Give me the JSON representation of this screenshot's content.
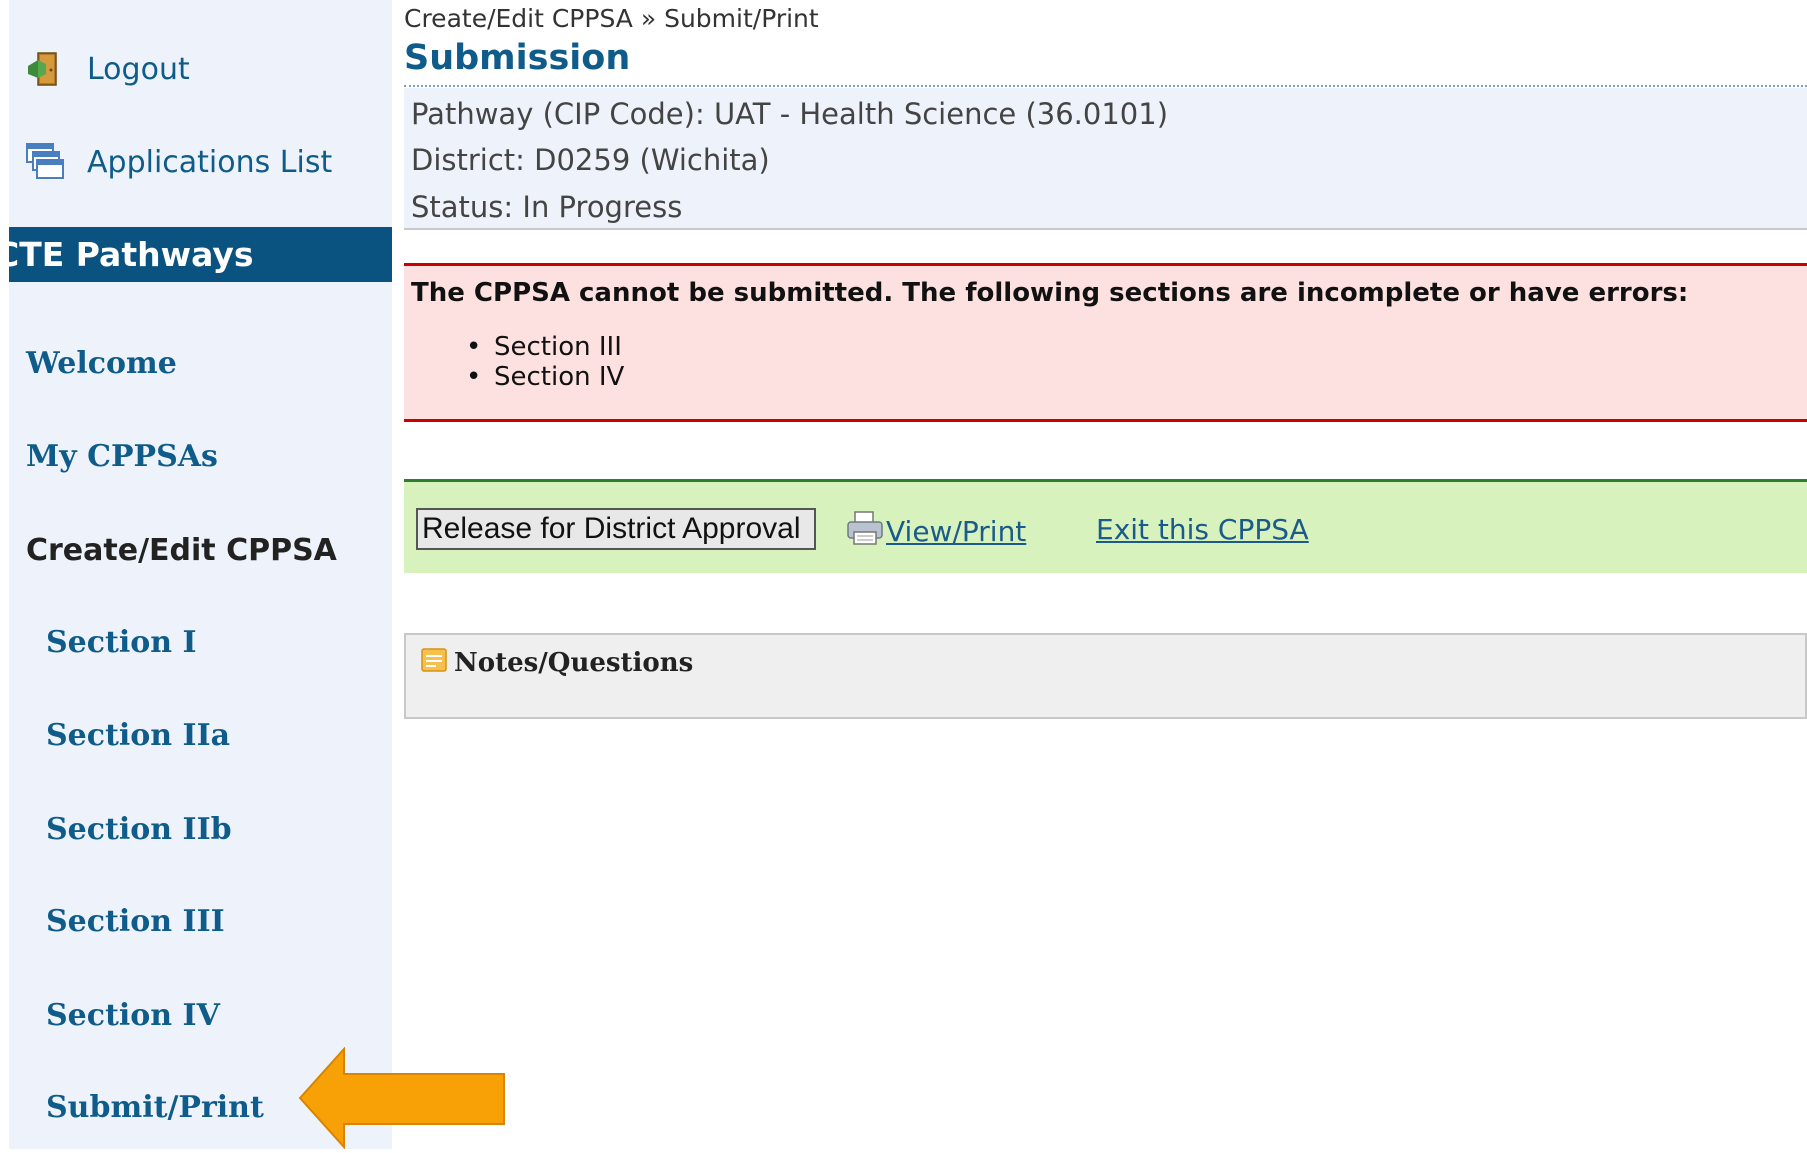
{
  "sidebar": {
    "logout_label": "Logout",
    "applications_label": "Applications List",
    "header": "CTE Pathways",
    "nav": {
      "welcome": "Welcome",
      "my_cppsas": "My CPPSAs",
      "create_edit": "Create/Edit CPPSA",
      "section_1": "Section I",
      "section_2a": "Section IIa",
      "section_2b": "Section IIb",
      "section_3": "Section III",
      "section_4": "Section IV",
      "submit_print": "Submit/Print"
    }
  },
  "main": {
    "breadcrumb": "Create/Edit CPPSA » Submit/Print",
    "title": "Submission",
    "info": {
      "pathway": "Pathway (CIP Code): UAT - Health Science (36.0101)",
      "district": "District: D0259 (Wichita)",
      "status": "Status: In Progress"
    },
    "error": {
      "message": "The CPPSA cannot be submitted. The following sections are incomplete or have errors:",
      "items": [
        "Section III",
        "Section IV"
      ]
    },
    "actions": {
      "release_label": "Release for District Approval",
      "view_print_label": "View/Print",
      "exit_label": "Exit this CPPSA"
    },
    "notes_title": "Notes/Questions"
  },
  "colors": {
    "accent": "#0f5c8a",
    "header_bg": "#0a5280",
    "error_border": "#cc0000",
    "success_border": "#2f7d2f",
    "arrow": "#f7a106"
  }
}
